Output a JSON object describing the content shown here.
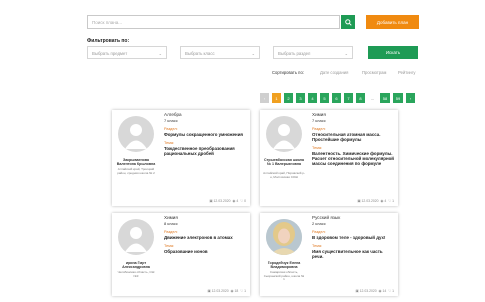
{
  "search": {
    "placeholder": "Поиск плана..."
  },
  "add_button": "Добавить план",
  "filter": {
    "label": "Фильтровать по:",
    "subject": "Выбрать предмет",
    "grade": "Выбрать класс",
    "section": "Выбрать раздел",
    "find_button": "Искать"
  },
  "sort": {
    "label": "Сортировать по:",
    "options": [
      "Дате создания",
      "Просмотрам",
      "Рейтингу"
    ]
  },
  "pagination": [
    "‹",
    "1",
    "2",
    "3",
    "4",
    "5",
    "6",
    "7",
    "8",
    "...",
    "58",
    "59",
    "›"
  ],
  "cards": [
    {
      "author": "Закрываенова Валентина Крыловна",
      "org": "Алтайский край, Троицкий район, средняя школа № 2",
      "subject": "Алгебра",
      "grade": "7 класс",
      "section_label": "Раздел:",
      "section": "Формулы сокращенного умножения",
      "topic_label": "Тема:",
      "topic": "Тождественное преобразования рациональных дробей",
      "date": "12.03.2020",
      "views": "4",
      "likes": "0"
    },
    {
      "author": "Стрыевбахская школа № 1 Валерьяновна",
      "org": "Алтайский край, Пировский р-н, Мостовская СОШ",
      "subject": "Химия",
      "grade": "7 класс",
      "section_label": "Раздел:",
      "section": "Относительная атомная масса. Простейшие формулы",
      "topic_label": "Тема:",
      "topic": "Валентность. Химические формулы. Расчет относительной молекулярной массы соединения по формуле",
      "date": "12.03.2020",
      "views": "4",
      "likes": "1"
    },
    {
      "author": "ирина Гмрт Александровна",
      "org": "Челябинская область, СШ №3",
      "subject": "Химия",
      "grade": "8 класс",
      "section_label": "Раздел:",
      "section": "Движение электронов в атомах",
      "topic_label": "Тема:",
      "topic": "Образование ионов",
      "date": "12.03.2020",
      "views": "18",
      "likes": "1"
    },
    {
      "author": "Городейчук Елена Владимировна",
      "org": "Самарская область, Сызранский район, школа № 1",
      "subject": "Русский язык",
      "grade": "2 класс",
      "section_label": "Раздел:",
      "section": "В здоровом теле - здоровый дух!",
      "topic_label": "Тема:",
      "topic": "Имя существительное как часть речи.",
      "date": "12.03.2020",
      "views": "14",
      "likes": "1"
    }
  ]
}
